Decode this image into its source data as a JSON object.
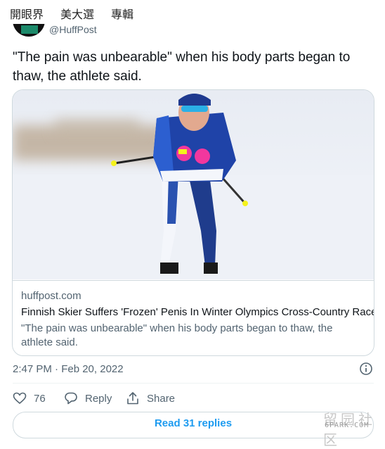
{
  "topnav": {
    "items": [
      "開眼界",
      "美大選",
      "專輯"
    ]
  },
  "author": {
    "handle": "@HuffPost"
  },
  "tweet": {
    "text": "\"The pain was unbearable\" when his body parts began to thaw, the athlete said."
  },
  "card": {
    "domain": "huffpost.com",
    "title": "Finnish Skier Suffers 'Frozen' Penis In Winter Olympics Cross-Country Race",
    "description": "\"The pain was unbearable\" when his body parts began to thaw, the athlete said."
  },
  "meta": {
    "timestamp": "2:47 PM · Feb 20, 2022"
  },
  "actions": {
    "likes": "76",
    "reply": "Reply",
    "share": "Share"
  },
  "replies_button": "Read 31 replies",
  "watermark": {
    "glyphs": "留园社区",
    "text": "6PARK.COM"
  },
  "colors": {
    "accent": "#1d9bf0",
    "secondary_text": "#536471",
    "border": "#cfd9de"
  }
}
